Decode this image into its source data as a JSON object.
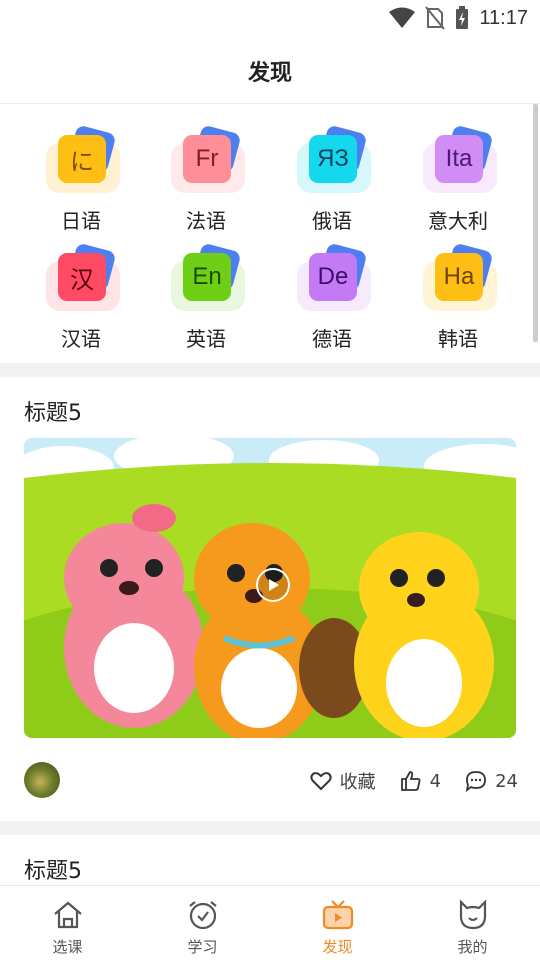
{
  "status": {
    "time": "11:17"
  },
  "header": {
    "title": "发现"
  },
  "languages": [
    {
      "label": "日语",
      "badge": "に",
      "tile_color": "#ffbe14",
      "shadow_color": "#ffd77a",
      "text_color": "#7a4f00"
    },
    {
      "label": "法语",
      "badge": "Fr",
      "tile_color": "#ff8e97",
      "shadow_color": "#ffc2c7",
      "text_color": "#7a1f2a"
    },
    {
      "label": "俄语",
      "badge": "ЯЗ",
      "tile_color": "#14d8ee",
      "shadow_color": "#8ae9f4",
      "text_color": "#0a3f60"
    },
    {
      "label": "意大利",
      "badge": "Ita",
      "tile_color": "#d18cf5",
      "shadow_color": "#e8c4fa",
      "text_color": "#4b1a70"
    },
    {
      "label": "汉语",
      "badge": "汉",
      "tile_color": "#ff4a63",
      "shadow_color": "#ffb0ba",
      "text_color": "#5a0010"
    },
    {
      "label": "英语",
      "badge": "En",
      "tile_color": "#6fcf17",
      "shadow_color": "#bfe8a0",
      "text_color": "#1f4d00"
    },
    {
      "label": "德语",
      "badge": "De",
      "tile_color": "#c57af5",
      "shadow_color": "#e6c6fa",
      "text_color": "#3c0f63"
    },
    {
      "label": "韩语",
      "badge": "Ha",
      "tile_color": "#ffbe14",
      "shadow_color": "#ffe08a",
      "text_color": "#6a4500"
    }
  ],
  "posts": [
    {
      "title": "标题5",
      "collect_label": "收藏",
      "likes": "4",
      "comments": "24"
    },
    {
      "title": "标题5"
    }
  ],
  "tabs": [
    {
      "label": "选课",
      "icon": "home-icon"
    },
    {
      "label": "学习",
      "icon": "alarm-clock-icon"
    },
    {
      "label": "发现",
      "icon": "tv-icon",
      "active": true
    },
    {
      "label": "我的",
      "icon": "cat-face-icon"
    }
  ],
  "colors": {
    "accent": "#f08a24",
    "gap": "#f2f2f2"
  }
}
